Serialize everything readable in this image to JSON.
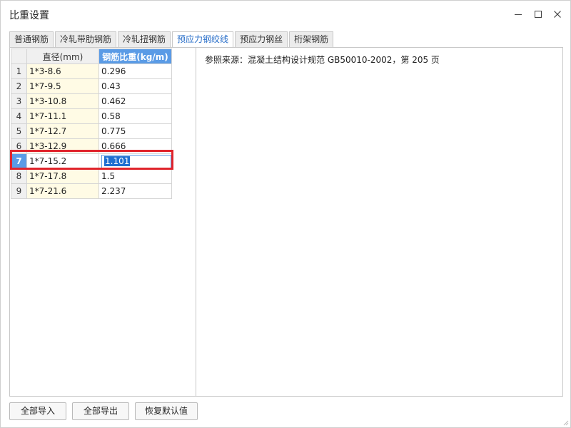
{
  "window": {
    "title": "比重设置"
  },
  "tabs": [
    {
      "label": "普通钢筋"
    },
    {
      "label": "冷轧带肋钢筋"
    },
    {
      "label": "冷轧扭钢筋"
    },
    {
      "label": "预应力钢绞线"
    },
    {
      "label": "预应力钢丝"
    },
    {
      "label": "桁架钢筋"
    }
  ],
  "active_tab": 3,
  "grid": {
    "headers": {
      "diameter": "直径(mm)",
      "weight": "钢筋比重(kg/m)"
    },
    "rows": [
      {
        "num": "1",
        "diameter": "1*3-8.6",
        "weight": "0.296"
      },
      {
        "num": "2",
        "diameter": "1*7-9.5",
        "weight": "0.43"
      },
      {
        "num": "3",
        "diameter": "1*3-10.8",
        "weight": "0.462"
      },
      {
        "num": "4",
        "diameter": "1*7-11.1",
        "weight": "0.58"
      },
      {
        "num": "5",
        "diameter": "1*7-12.7",
        "weight": "0.775"
      },
      {
        "num": "6",
        "diameter": "1*3-12.9",
        "weight": "0.666"
      },
      {
        "num": "7",
        "diameter": "1*7-15.2",
        "weight": "1.101"
      },
      {
        "num": "8",
        "diameter": "1*7-17.8",
        "weight": "1.5"
      },
      {
        "num": "9",
        "diameter": "1*7-21.6",
        "weight": "2.237"
      }
    ],
    "selected_row": 6
  },
  "reference": {
    "text": "参照来源：混凝土结构设计规范 GB50010-2002，第 205 页"
  },
  "buttons": {
    "import_all": "全部导入",
    "export_all": "全部导出",
    "restore_default": "恢复默认值"
  },
  "colors": {
    "accent": "#5a9be6",
    "selection": "#1e6fd0",
    "highlight_frame": "#e0242c",
    "diameter_cell_bg": "#fffbe5"
  }
}
